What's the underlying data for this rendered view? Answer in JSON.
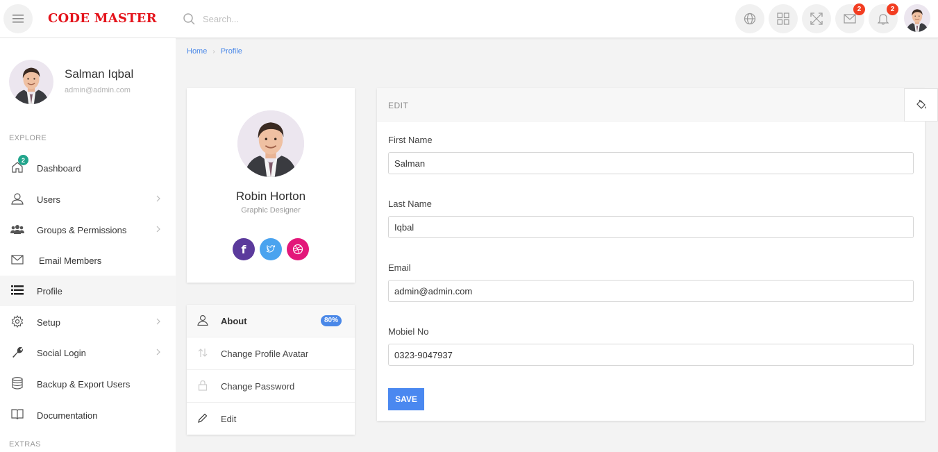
{
  "topbar": {
    "brand": "CODE MASTER",
    "search_placeholder": "Search...",
    "messages_badge": "2",
    "notifications_badge": "2"
  },
  "sidebar": {
    "user_name": "Salman Iqbal",
    "user_email": "admin@admin.com",
    "section_explore": "EXPLORE",
    "section_extras": "EXTRAS",
    "items": [
      {
        "label": "Dashboard",
        "icon": "home-icon",
        "badge": "2"
      },
      {
        "label": "Users",
        "icon": "user-icon"
      },
      {
        "label": "Groups & Permissions",
        "icon": "users-group-icon"
      },
      {
        "label": "Email Members",
        "icon": "envelope-icon"
      },
      {
        "label": "Profile",
        "icon": "list-icon"
      },
      {
        "label": "Setup",
        "icon": "gear-icon"
      },
      {
        "label": "Social Login",
        "icon": "wrench-icon"
      },
      {
        "label": "Backup & Export Users",
        "icon": "database-icon"
      },
      {
        "label": "Documentation",
        "icon": "book-icon"
      }
    ]
  },
  "breadcrumb": {
    "home": "Home",
    "current": "Profile"
  },
  "profile_card": {
    "name": "Robin Horton",
    "role": "Graphic Designer"
  },
  "profile_menu": {
    "items": [
      {
        "label": "About",
        "badge": "80%"
      },
      {
        "label": "Change Profile Avatar"
      },
      {
        "label": "Change Password"
      },
      {
        "label": "Edit"
      }
    ]
  },
  "edit_form": {
    "title": "EDIT",
    "first_name_label": "First Name",
    "first_name_value": "Salman",
    "last_name_label": "Last Name",
    "last_name_value": "Iqbal",
    "email_label": "Email",
    "email_value": "admin@admin.com",
    "mobile_label": "Mobiel No",
    "mobile_value": "0323-9047937",
    "save_label": "SAVE"
  },
  "colors": {
    "brand": "#e4131b",
    "accent": "#4a88f0",
    "badge_red": "#f23d21",
    "badge_green": "#21a58c",
    "facebook": "#5b3a9c",
    "twitter": "#4aa3ef",
    "dribbble": "#e3177a"
  }
}
